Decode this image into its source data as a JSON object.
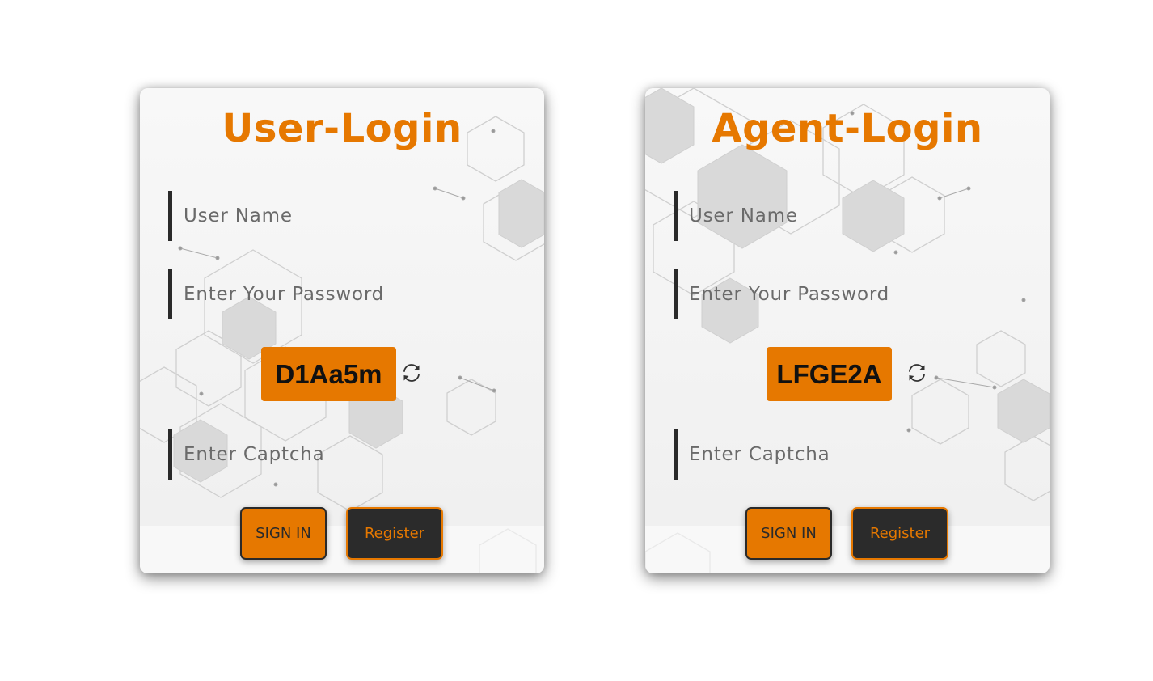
{
  "user_login": {
    "title": "User-Login",
    "username_placeholder": "User Name",
    "password_placeholder": "Enter Your Password",
    "captcha_code": "D1Aa5m",
    "captcha_placeholder": "Enter Captcha",
    "signin_label": "SIGN IN",
    "register_label": "Register"
  },
  "agent_login": {
    "title": "Agent-Login",
    "username_placeholder": "User Name",
    "password_placeholder": "Enter Your Password",
    "captcha_code": "LFGE2A",
    "captcha_placeholder": "Enter Captcha",
    "signin_label": "SIGN IN",
    "register_label": "Register"
  },
  "icons": {
    "refresh": "refresh-icon"
  },
  "colors": {
    "accent": "#e67800",
    "dark": "#2b2b2b",
    "card_background": "#f4f4f4"
  }
}
